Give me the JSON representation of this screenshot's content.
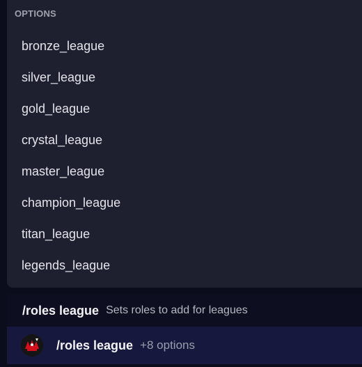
{
  "options_panel": {
    "header": "OPTIONS",
    "items": [
      {
        "label": "bronze_league"
      },
      {
        "label": "silver_league"
      },
      {
        "label": "gold_league"
      },
      {
        "label": "crystal_league"
      },
      {
        "label": "master_league"
      },
      {
        "label": "champion_league"
      },
      {
        "label": "titan_league"
      },
      {
        "label": "legends_league"
      }
    ]
  },
  "command_hint": {
    "name": "/roles league",
    "description": "Sets roles to add for leagues"
  },
  "autocomplete": {
    "avatar_icon": "bot-app-icon",
    "command": "/roles league",
    "extra_options": "+8 options"
  },
  "colors": {
    "background": "#0c0d1c",
    "panel": "#1e1f2f",
    "selected_row": "#16183d",
    "accent_red": "#d4101d"
  }
}
